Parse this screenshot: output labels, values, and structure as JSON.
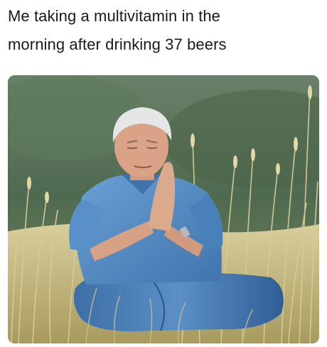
{
  "caption": {
    "line1": "Me taking a multivitamin in the",
    "line2": "morning after drinking 37 beers"
  },
  "photo": {
    "subject": "gray-haired man in a blue denim shirt and jeans sitting cross-legged with hands pressed together in prayer in a field of tall dry grass",
    "colors": {
      "hillside": "#5b7558",
      "grass": "#c9bf8a",
      "denim": "#4f86bf",
      "skin": "#d9a588",
      "hair": "#e6e6e6"
    }
  }
}
